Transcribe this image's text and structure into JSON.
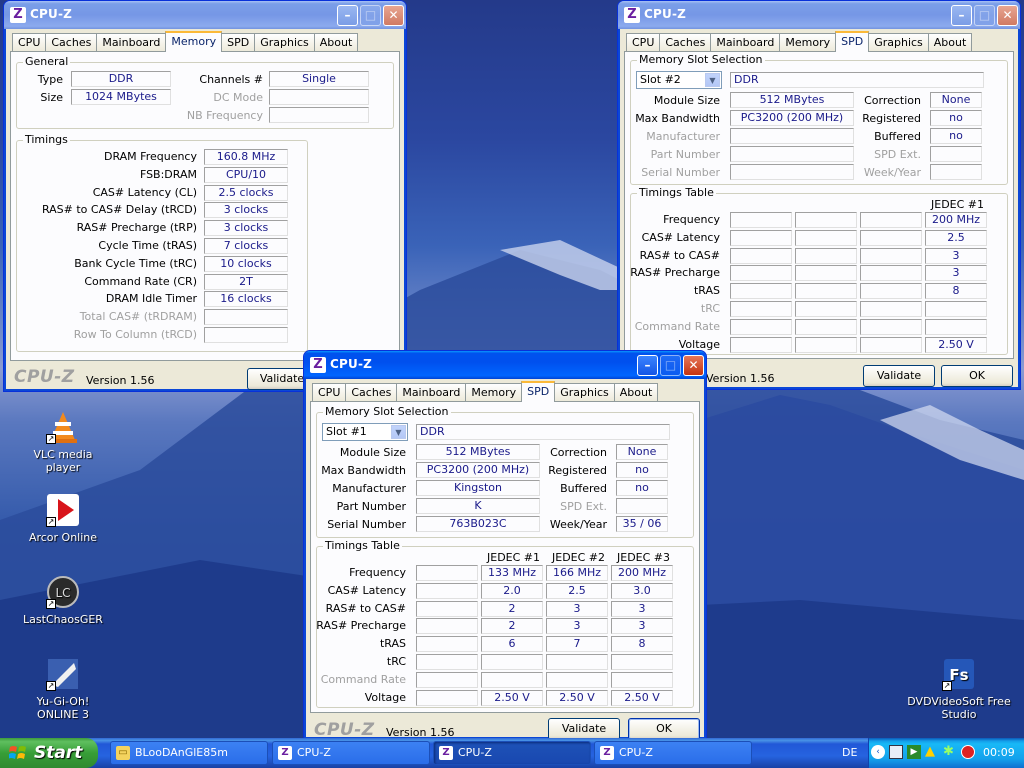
{
  "desktop": {
    "icons": [
      {
        "label": "VLC media player"
      },
      {
        "label": "Arcor Online"
      },
      {
        "label": "LastChaosGER"
      },
      {
        "label": "Yu-Gi-Oh! ONLINE 3"
      },
      {
        "label": "DVDVideoSoft Free Studio"
      }
    ]
  },
  "tabs": [
    "CPU",
    "Caches",
    "Mainboard",
    "Memory",
    "SPD",
    "Graphics",
    "About"
  ],
  "window_title": "CPU-Z",
  "brand": "CPU-Z",
  "version": "Version 1.56",
  "validate": "Validate",
  "ok": "OK",
  "mem": {
    "general": "General",
    "type_l": "Type",
    "type": "DDR",
    "size_l": "Size",
    "size": "1024 MBytes",
    "channels_l": "Channels #",
    "channels": "Single",
    "dcmode_l": "DC Mode",
    "nbfreq_l": "NB Frequency",
    "timings": "Timings",
    "rows": [
      {
        "l": "DRAM Frequency",
        "v": "160.8 MHz"
      },
      {
        "l": "FSB:DRAM",
        "v": "CPU/10"
      },
      {
        "l": "CAS# Latency (CL)",
        "v": "2.5 clocks"
      },
      {
        "l": "RAS# to CAS# Delay (tRCD)",
        "v": "3 clocks"
      },
      {
        "l": "RAS# Precharge (tRP)",
        "v": "3 clocks"
      },
      {
        "l": "Cycle Time (tRAS)",
        "v": "7 clocks"
      },
      {
        "l": "Bank Cycle Time (tRC)",
        "v": "10 clocks"
      },
      {
        "l": "Command Rate (CR)",
        "v": "2T"
      },
      {
        "l": "DRAM Idle Timer",
        "v": "16 clocks"
      },
      {
        "l": "Total CAS# (tRDRAM)",
        "v": ""
      },
      {
        "l": "Row To Column (tRCD)",
        "v": ""
      }
    ]
  },
  "spd_labels": {
    "slot_sel": "Memory Slot Selection",
    "module_size": "Module Size",
    "max_bw": "Max Bandwidth",
    "manufacturer": "Manufacturer",
    "part": "Part Number",
    "serial": "Serial Number",
    "correction": "Correction",
    "registered": "Registered",
    "buffered": "Buffered",
    "spdext": "SPD Ext.",
    "weekyear": "Week/Year",
    "timings_table": "Timings Table",
    "trows": [
      "Frequency",
      "CAS# Latency",
      "RAS# to CAS#",
      "RAS# Precharge",
      "tRAS",
      "tRC",
      "Command Rate",
      "Voltage"
    ]
  },
  "spd2": {
    "slot": "Slot #2",
    "type": "DDR",
    "module_size": "512 MBytes",
    "max_bw": "PC3200 (200 MHz)",
    "correction": "None",
    "registered": "no",
    "buffered": "no",
    "jedec": "JEDEC #1",
    "col": [
      "200 MHz",
      "2.5",
      "3",
      "3",
      "8",
      "",
      "",
      "2.50 V"
    ]
  },
  "spd1": {
    "slot": "Slot #1",
    "type": "DDR",
    "module_size": "512 MBytes",
    "max_bw": "PC3200 (200 MHz)",
    "manufacturer": "Kingston",
    "part": "K",
    "serial": "763B023C",
    "correction": "None",
    "registered": "no",
    "buffered": "no",
    "weekyear": "35 / 06",
    "jedec": [
      "JEDEC #1",
      "JEDEC #2",
      "JEDEC #3"
    ],
    "cols": [
      [
        "133 MHz",
        "2.0",
        "2",
        "2",
        "6",
        "",
        "",
        "2.50 V"
      ],
      [
        "166 MHz",
        "2.5",
        "3",
        "3",
        "7",
        "",
        "",
        "2.50 V"
      ],
      [
        "200 MHz",
        "3.0",
        "3",
        "3",
        "8",
        "",
        "",
        "2.50 V"
      ]
    ]
  },
  "taskbar": {
    "start": "Start",
    "items": [
      {
        "label": "BLooDAnGlE85m"
      },
      {
        "label": "CPU-Z"
      },
      {
        "label": "CPU-Z"
      },
      {
        "label": "CPU-Z"
      }
    ],
    "lang": "DE",
    "time": "00:09"
  }
}
